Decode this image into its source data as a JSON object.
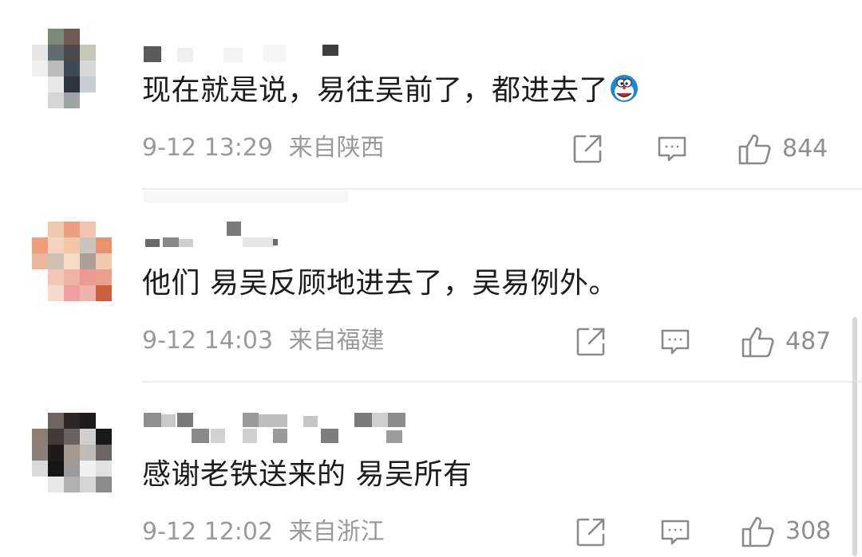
{
  "comments": [
    {
      "text": "现在就是说，易往吴前了，都进去了",
      "date": "9-12 13:29",
      "location": "来自陕西",
      "likes": "844",
      "emoji": "doraemon-emoji"
    },
    {
      "text": "他们 易吴反顾地进去了，吴易例外。",
      "date": "9-12 14:03",
      "location": "来自福建",
      "likes": "487"
    },
    {
      "text": "感谢老铁送来的 易吴所有",
      "date": "9-12 12:02",
      "location": "来自浙江",
      "likes": "308"
    }
  ],
  "icons": {
    "share": "share-icon",
    "reply": "comment-icon",
    "like": "thumbs-up-icon"
  },
  "colors": {
    "text": "#1c1c1c",
    "meta": "#9a9a9a",
    "icon": "#8a8a8a",
    "divider": "#ececec"
  }
}
